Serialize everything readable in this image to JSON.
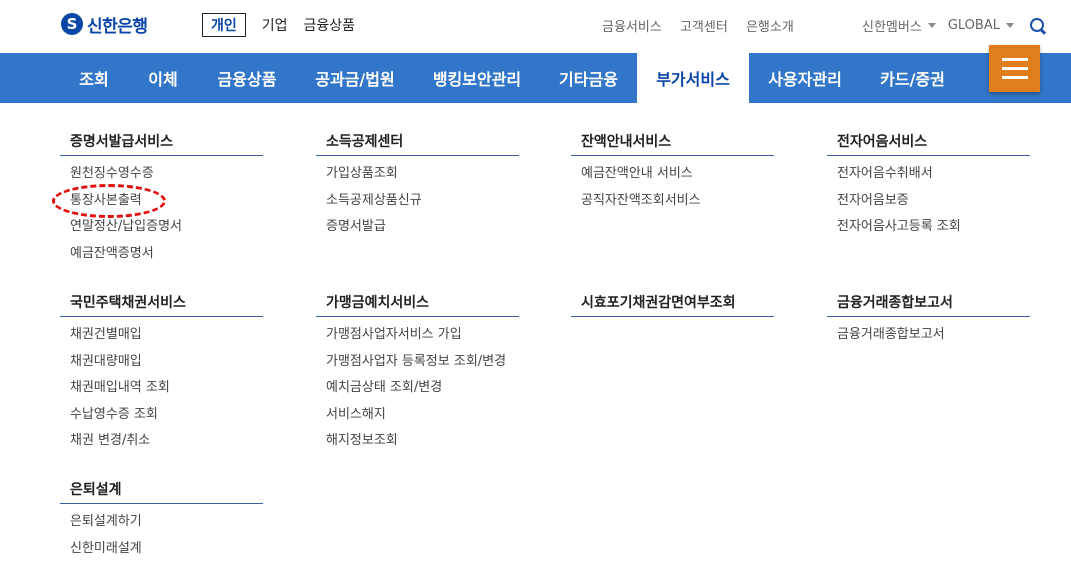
{
  "header": {
    "logo_mark": "S",
    "logo_text": "신한은행",
    "segments": [
      "개인",
      "기업",
      "금융상품"
    ],
    "util_links": [
      "금융서비스",
      "고객센터",
      "은행소개"
    ],
    "member_link": "신한멤버스",
    "lang": "GLOBAL",
    "accent_color": "#0a46a8"
  },
  "nav": {
    "color": "#3276c9",
    "items": [
      "조회",
      "이체",
      "금융상품",
      "공과금/법원",
      "뱅킹보안관리",
      "기타금융",
      "부가서비스",
      "사용자관리",
      "카드/증권"
    ],
    "active": "부가서비스",
    "menu_button_color": "#e07e1d"
  },
  "menu": {
    "sections": [
      {
        "title": "증명서발급서비스",
        "items": [
          "원천징수영수증",
          "통장사본출력",
          "연말정산/납입증명서",
          "예금잔액증명서"
        ]
      },
      {
        "title": "소득공제센터",
        "items": [
          "가입상품조회",
          "소득공제상품신규",
          "증명서발급"
        ]
      },
      {
        "title": "잔액안내서비스",
        "items": [
          "예금잔액안내 서비스",
          "공직자잔액조회서비스"
        ]
      },
      {
        "title": "전자어음서비스",
        "items": [
          "전자어음수취배서",
          "전자어음보증",
          "전자어음사고등록 조회"
        ]
      },
      {
        "title": "국민주택채권서비스",
        "items": [
          "채권건별매입",
          "채권대량매입",
          "채권매입내역 조회",
          "수납영수증 조회",
          "채권 변경/취소"
        ]
      },
      {
        "title": "가맹금예치서비스",
        "items": [
          "가맹점사업자서비스 가입",
          "가맹점사업자 등록정보 조회/변경",
          "예치금상태 조회/변경",
          "서비스해지",
          "해지정보조회"
        ]
      },
      {
        "title": "시효포기채권감면여부조회",
        "items": []
      },
      {
        "title": "금융거래종합보고서",
        "items": [
          "금융거래종합보고서"
        ]
      },
      {
        "title": "은퇴설계",
        "items": [
          "은퇴설계하기",
          "신한미래설계"
        ]
      }
    ],
    "highlight_color": "#e01010"
  }
}
